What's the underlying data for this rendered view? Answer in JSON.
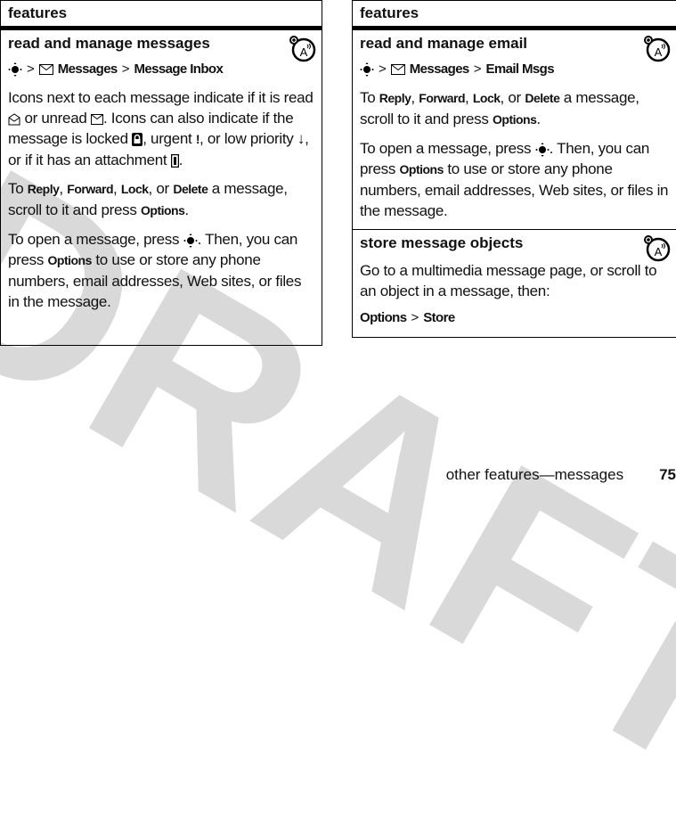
{
  "watermark": "DRAFT",
  "left_panel": {
    "header": "features",
    "sections": [
      {
        "title": "read and manage messages",
        "nav": {
          "sep": ">",
          "item1": "Messages",
          "item2": "Message Inbox"
        },
        "para1": {
          "line": "Icons next to each message indicate if it is read",
          "t2": "or unread",
          "t3": ". Icons can also indicate if the message is locked",
          "t4": ", urgent",
          "t5": ", or low priority",
          "t6": ", or if it has an attachment",
          "t7": "."
        },
        "para2": {
          "pre": "To ",
          "a": "Reply",
          "c1": ", ",
          "b": "Forward",
          "c2": ", ",
          "c": "Lock",
          "c3": ", or ",
          "d": "Delete",
          "post": " a message, scroll to it and press ",
          "opt": "Options",
          "end": "."
        },
        "para3": {
          "pre": "To open a message, press",
          "mid": ". Then, you can press ",
          "opt": "Options",
          "post": " to use or store any phone numbers, email addresses, Web sites, or files in the message."
        }
      }
    ]
  },
  "right_panel": {
    "header": "features",
    "sections": [
      {
        "title": "read and manage email",
        "nav": {
          "sep": ">",
          "item1": "Messages",
          "item2": "Email Msgs"
        },
        "para2": {
          "pre": "To ",
          "a": "Reply",
          "c1": ", ",
          "b": "Forward",
          "c2": ", ",
          "c": "Lock",
          "c3": ", or ",
          "d": "Delete",
          "post": " a message, scroll to it and press ",
          "opt": "Options",
          "end": "."
        },
        "para3": {
          "pre": "To open a message, press",
          "mid": ". Then, you can press ",
          "opt": "Options",
          "post": " to use or store any phone numbers, email addresses, Web sites, or files in the message."
        }
      },
      {
        "title": "store message objects",
        "para": "Go to a multimedia message page, or scroll to an object in a message, then:",
        "nav": {
          "a": "Options",
          "sep": ">",
          "b": "Store"
        }
      }
    ]
  },
  "footer": {
    "section": "other features—messages",
    "page": "75"
  }
}
